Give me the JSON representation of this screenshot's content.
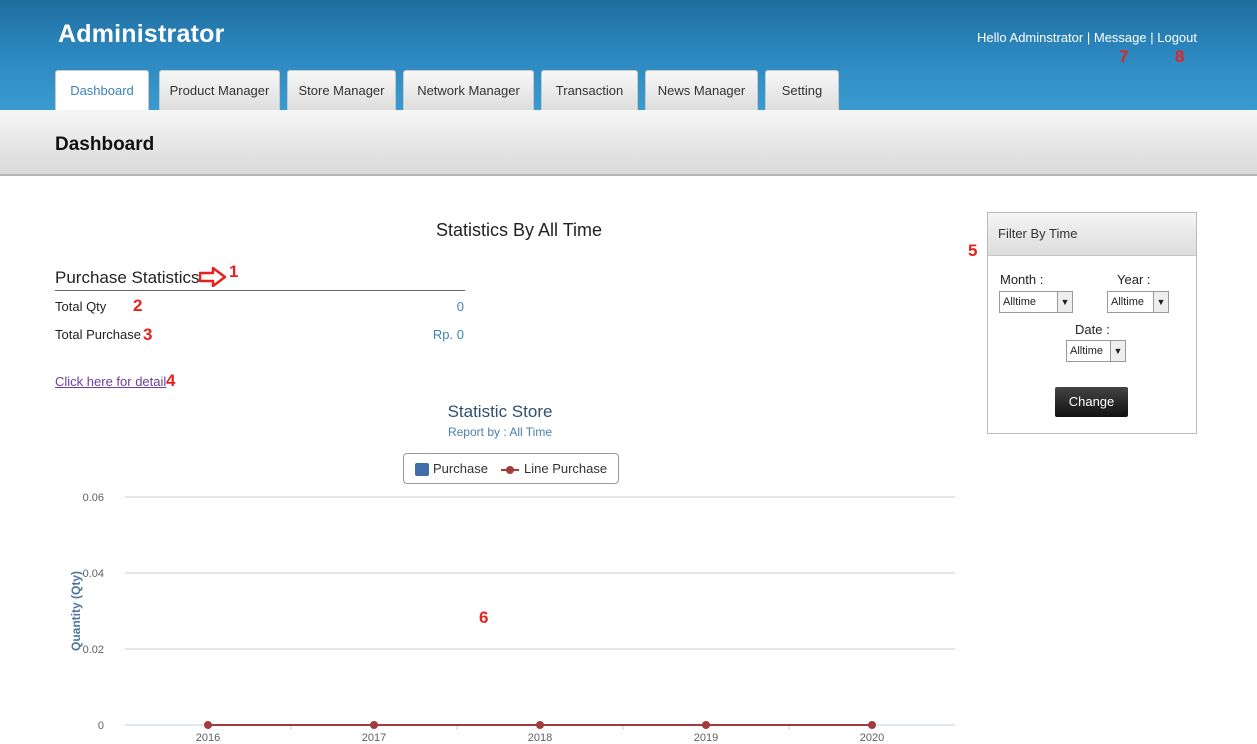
{
  "header": {
    "app_title": "Administrator",
    "greeting": "Hello  Adminstrator",
    "message_link": "Message",
    "logout_link": "Logout",
    "marker_message": "7",
    "marker_logout": "8",
    "tabs": [
      {
        "label": "Dashboard",
        "active": true
      },
      {
        "label": "Product Manager"
      },
      {
        "label": "Store Manager"
      },
      {
        "label": "Network Manager"
      },
      {
        "label": "Transaction"
      },
      {
        "label": "News Manager"
      },
      {
        "label": "Setting"
      }
    ]
  },
  "subbar": {
    "title": "Dashboard"
  },
  "main": {
    "stats_title": "Statistics By All Time",
    "purchase_title": "Purchase Statistics",
    "total_qty_label": "Total Qty",
    "total_qty_value": "0",
    "total_purchase_label": "Total Purchase",
    "total_purchase_value": "Rp. 0",
    "detail_link": "Click here for detail",
    "markers": {
      "m1": "1",
      "m2": "2",
      "m3": "3",
      "m4": "4",
      "m5": "5",
      "m6": "6"
    }
  },
  "filter": {
    "title": "Filter By Time",
    "month_label": "Month :",
    "month_value": "Alltime",
    "year_label": "Year :",
    "year_value": "Alltime",
    "date_label": "Date :",
    "date_value": "Alltime",
    "button": "Change"
  },
  "colors": {
    "purchase": "#3f6fa9",
    "line_purchase": "#a23b3b"
  },
  "chart_data": {
    "type": "bar",
    "title": "Statistic Store",
    "subtitle": "Report by : All Time",
    "xlabel": "",
    "ylabel": "Quantity (Qty)",
    "categories": [
      "2016",
      "2017",
      "2018",
      "2019",
      "2020"
    ],
    "ylim": [
      0,
      0.06
    ],
    "yticks": [
      "0",
      "0.02",
      "0.04",
      "0.06"
    ],
    "grid": true,
    "legend_position": "top-center",
    "series": [
      {
        "name": "Purchase",
        "type": "bar",
        "values": [
          0,
          0,
          0,
          0,
          0
        ]
      },
      {
        "name": "Line Purchase",
        "type": "line",
        "values": [
          0,
          0,
          0,
          0,
          0
        ]
      }
    ]
  }
}
